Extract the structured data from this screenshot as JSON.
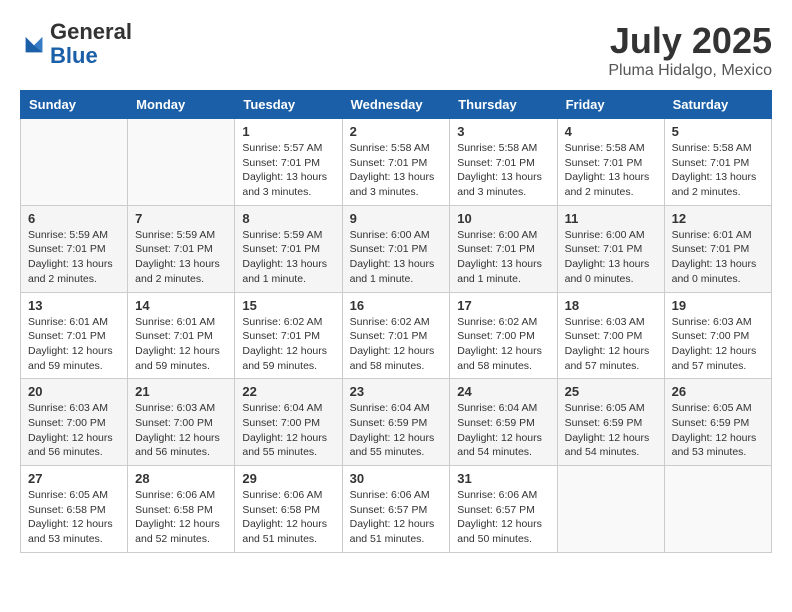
{
  "logo": {
    "general": "General",
    "blue": "Blue"
  },
  "header": {
    "month": "July 2025",
    "location": "Pluma Hidalgo, Mexico"
  },
  "weekdays": [
    "Sunday",
    "Monday",
    "Tuesday",
    "Wednesday",
    "Thursday",
    "Friday",
    "Saturday"
  ],
  "weeks": [
    [
      {
        "day": "",
        "info": ""
      },
      {
        "day": "",
        "info": ""
      },
      {
        "day": "1",
        "info": "Sunrise: 5:57 AM\nSunset: 7:01 PM\nDaylight: 13 hours and 3 minutes."
      },
      {
        "day": "2",
        "info": "Sunrise: 5:58 AM\nSunset: 7:01 PM\nDaylight: 13 hours and 3 minutes."
      },
      {
        "day": "3",
        "info": "Sunrise: 5:58 AM\nSunset: 7:01 PM\nDaylight: 13 hours and 3 minutes."
      },
      {
        "day": "4",
        "info": "Sunrise: 5:58 AM\nSunset: 7:01 PM\nDaylight: 13 hours and 2 minutes."
      },
      {
        "day": "5",
        "info": "Sunrise: 5:58 AM\nSunset: 7:01 PM\nDaylight: 13 hours and 2 minutes."
      }
    ],
    [
      {
        "day": "6",
        "info": "Sunrise: 5:59 AM\nSunset: 7:01 PM\nDaylight: 13 hours and 2 minutes."
      },
      {
        "day": "7",
        "info": "Sunrise: 5:59 AM\nSunset: 7:01 PM\nDaylight: 13 hours and 2 minutes."
      },
      {
        "day": "8",
        "info": "Sunrise: 5:59 AM\nSunset: 7:01 PM\nDaylight: 13 hours and 1 minute."
      },
      {
        "day": "9",
        "info": "Sunrise: 6:00 AM\nSunset: 7:01 PM\nDaylight: 13 hours and 1 minute."
      },
      {
        "day": "10",
        "info": "Sunrise: 6:00 AM\nSunset: 7:01 PM\nDaylight: 13 hours and 1 minute."
      },
      {
        "day": "11",
        "info": "Sunrise: 6:00 AM\nSunset: 7:01 PM\nDaylight: 13 hours and 0 minutes."
      },
      {
        "day": "12",
        "info": "Sunrise: 6:01 AM\nSunset: 7:01 PM\nDaylight: 13 hours and 0 minutes."
      }
    ],
    [
      {
        "day": "13",
        "info": "Sunrise: 6:01 AM\nSunset: 7:01 PM\nDaylight: 12 hours and 59 minutes."
      },
      {
        "day": "14",
        "info": "Sunrise: 6:01 AM\nSunset: 7:01 PM\nDaylight: 12 hours and 59 minutes."
      },
      {
        "day": "15",
        "info": "Sunrise: 6:02 AM\nSunset: 7:01 PM\nDaylight: 12 hours and 59 minutes."
      },
      {
        "day": "16",
        "info": "Sunrise: 6:02 AM\nSunset: 7:01 PM\nDaylight: 12 hours and 58 minutes."
      },
      {
        "day": "17",
        "info": "Sunrise: 6:02 AM\nSunset: 7:00 PM\nDaylight: 12 hours and 58 minutes."
      },
      {
        "day": "18",
        "info": "Sunrise: 6:03 AM\nSunset: 7:00 PM\nDaylight: 12 hours and 57 minutes."
      },
      {
        "day": "19",
        "info": "Sunrise: 6:03 AM\nSunset: 7:00 PM\nDaylight: 12 hours and 57 minutes."
      }
    ],
    [
      {
        "day": "20",
        "info": "Sunrise: 6:03 AM\nSunset: 7:00 PM\nDaylight: 12 hours and 56 minutes."
      },
      {
        "day": "21",
        "info": "Sunrise: 6:03 AM\nSunset: 7:00 PM\nDaylight: 12 hours and 56 minutes."
      },
      {
        "day": "22",
        "info": "Sunrise: 6:04 AM\nSunset: 7:00 PM\nDaylight: 12 hours and 55 minutes."
      },
      {
        "day": "23",
        "info": "Sunrise: 6:04 AM\nSunset: 6:59 PM\nDaylight: 12 hours and 55 minutes."
      },
      {
        "day": "24",
        "info": "Sunrise: 6:04 AM\nSunset: 6:59 PM\nDaylight: 12 hours and 54 minutes."
      },
      {
        "day": "25",
        "info": "Sunrise: 6:05 AM\nSunset: 6:59 PM\nDaylight: 12 hours and 54 minutes."
      },
      {
        "day": "26",
        "info": "Sunrise: 6:05 AM\nSunset: 6:59 PM\nDaylight: 12 hours and 53 minutes."
      }
    ],
    [
      {
        "day": "27",
        "info": "Sunrise: 6:05 AM\nSunset: 6:58 PM\nDaylight: 12 hours and 53 minutes."
      },
      {
        "day": "28",
        "info": "Sunrise: 6:06 AM\nSunset: 6:58 PM\nDaylight: 12 hours and 52 minutes."
      },
      {
        "day": "29",
        "info": "Sunrise: 6:06 AM\nSunset: 6:58 PM\nDaylight: 12 hours and 51 minutes."
      },
      {
        "day": "30",
        "info": "Sunrise: 6:06 AM\nSunset: 6:57 PM\nDaylight: 12 hours and 51 minutes."
      },
      {
        "day": "31",
        "info": "Sunrise: 6:06 AM\nSunset: 6:57 PM\nDaylight: 12 hours and 50 minutes."
      },
      {
        "day": "",
        "info": ""
      },
      {
        "day": "",
        "info": ""
      }
    ]
  ]
}
